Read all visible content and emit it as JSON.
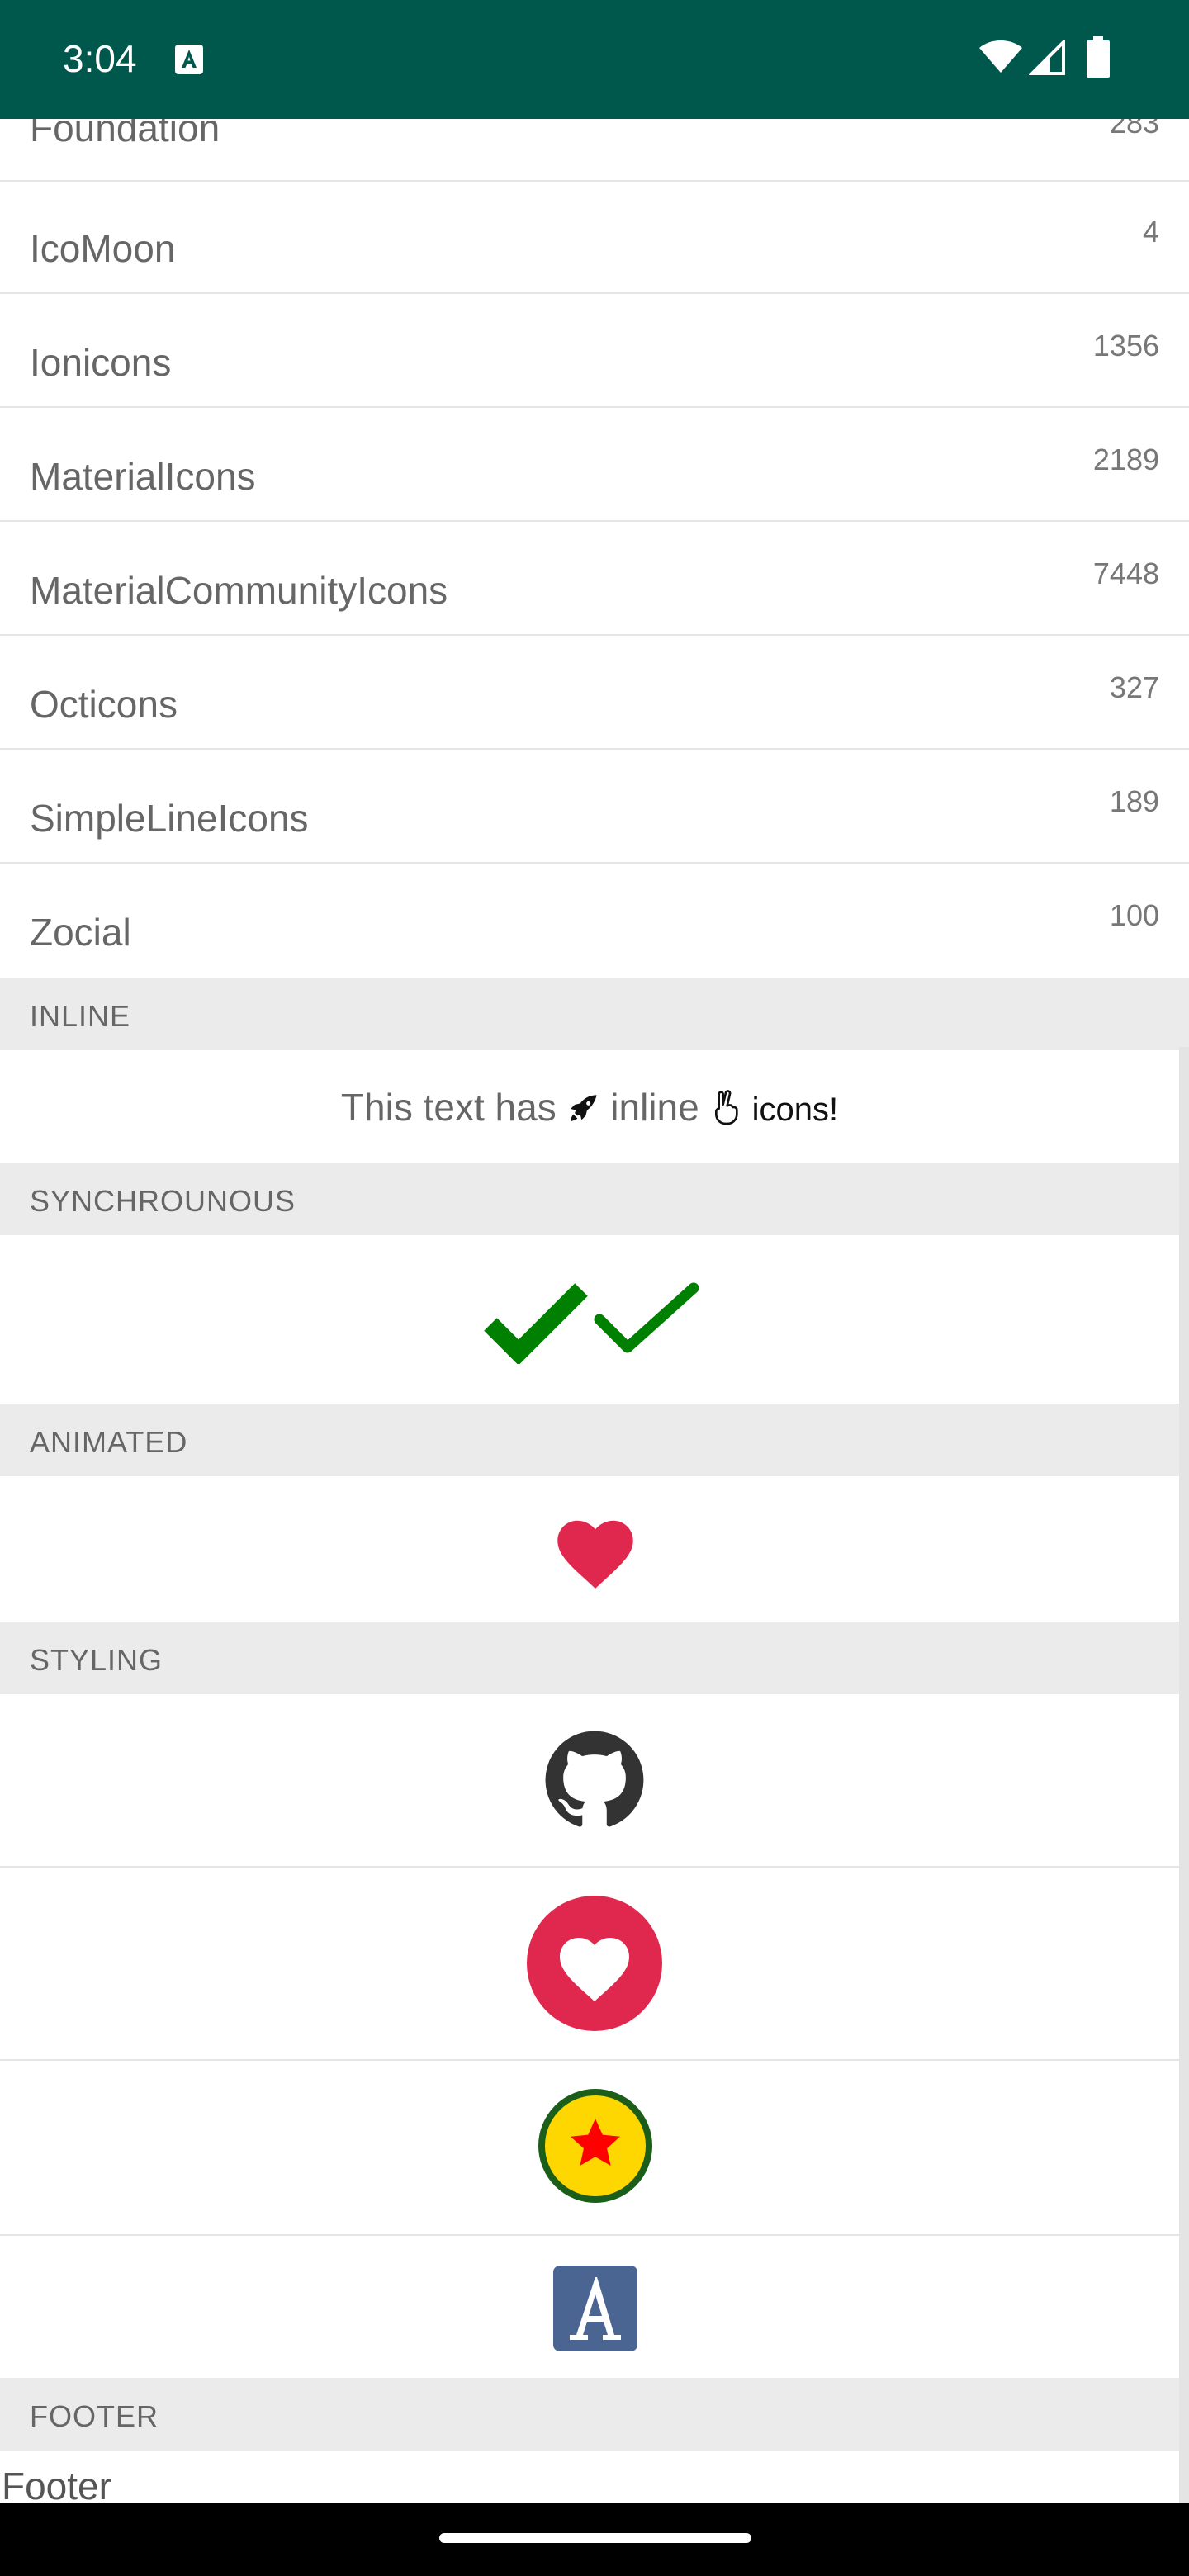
{
  "status_bar": {
    "time": "3:04",
    "notification_icon": "a-box-icon",
    "wifi_icon": "wifi-icon",
    "signal_icon": "cell-signal-icon",
    "battery_icon": "battery-icon"
  },
  "icon_sets": [
    {
      "name": "Foundation",
      "count": "283"
    },
    {
      "name": "IcoMoon",
      "count": "4"
    },
    {
      "name": "Ionicons",
      "count": "1356"
    },
    {
      "name": "MaterialIcons",
      "count": "2189"
    },
    {
      "name": "MaterialCommunityIcons",
      "count": "7448"
    },
    {
      "name": "Octicons",
      "count": "327"
    },
    {
      "name": "SimpleLineIcons",
      "count": "189"
    },
    {
      "name": "Zocial",
      "count": "100"
    }
  ],
  "sections": {
    "inline": "INLINE",
    "synchronous": "SYNCHROUNOUS",
    "animated": "ANIMATED",
    "styling": "STYLING",
    "footer": "FOOTER"
  },
  "inline_demo": {
    "part1": "This text has ",
    "part2": " inline ",
    "part3": " icons!",
    "icon1": "rocket-icon",
    "icon2": "peace-hand-icon"
  },
  "synchronous_icons": [
    "check-bold-icon",
    "check-icon"
  ],
  "animated_icon": "heart-icon",
  "styling_icons": [
    "github-icon",
    "heart-circle-icon",
    "star-circle-icon",
    "font-a-icon"
  ],
  "footer": {
    "text": "Footer"
  },
  "colors": {
    "status_bar": "#00574b",
    "check": "#008000",
    "heart": "#e0284f",
    "github": "#333333",
    "star_bg": "#ffd700",
    "star": "#ff0000",
    "star_border": "#1a5e1a",
    "font_box": "#4a6592"
  }
}
